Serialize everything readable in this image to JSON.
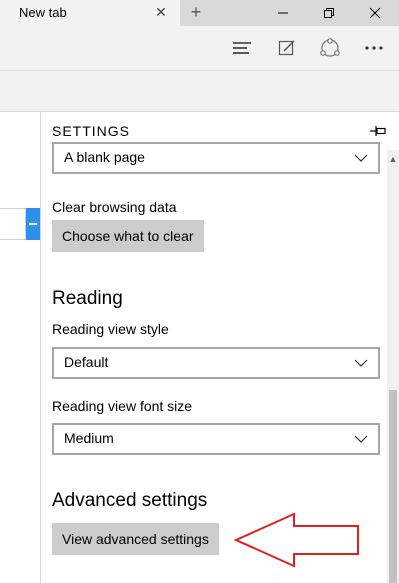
{
  "browser": {
    "tab_title": "New tab",
    "tab_close_icon": "close-icon",
    "new_tab_icon": "plus-icon",
    "window_controls": [
      "minimize-icon",
      "maximize-icon",
      "close-icon"
    ],
    "toolbar_icons": [
      "hub-icon",
      "web-note-icon",
      "share-icon",
      "more-icon"
    ]
  },
  "settings": {
    "title": "SETTINGS",
    "pin_icon": "pin-icon",
    "open_with_value": "A blank page",
    "clear_browsing_data_label": "Clear browsing data",
    "choose_what_to_clear_label": "Choose what to clear",
    "reading_heading": "Reading",
    "reading_view_style_label": "Reading view style",
    "reading_view_style_value": "Default",
    "reading_view_font_size_label": "Reading view font size",
    "reading_view_font_size_value": "Medium",
    "advanced_heading": "Advanced settings",
    "view_advanced_label": "View advanced settings"
  },
  "colors": {
    "accent_blue": "#2d8ff0",
    "annotation_red": "#e02020",
    "button_gray": "#cccccc"
  }
}
